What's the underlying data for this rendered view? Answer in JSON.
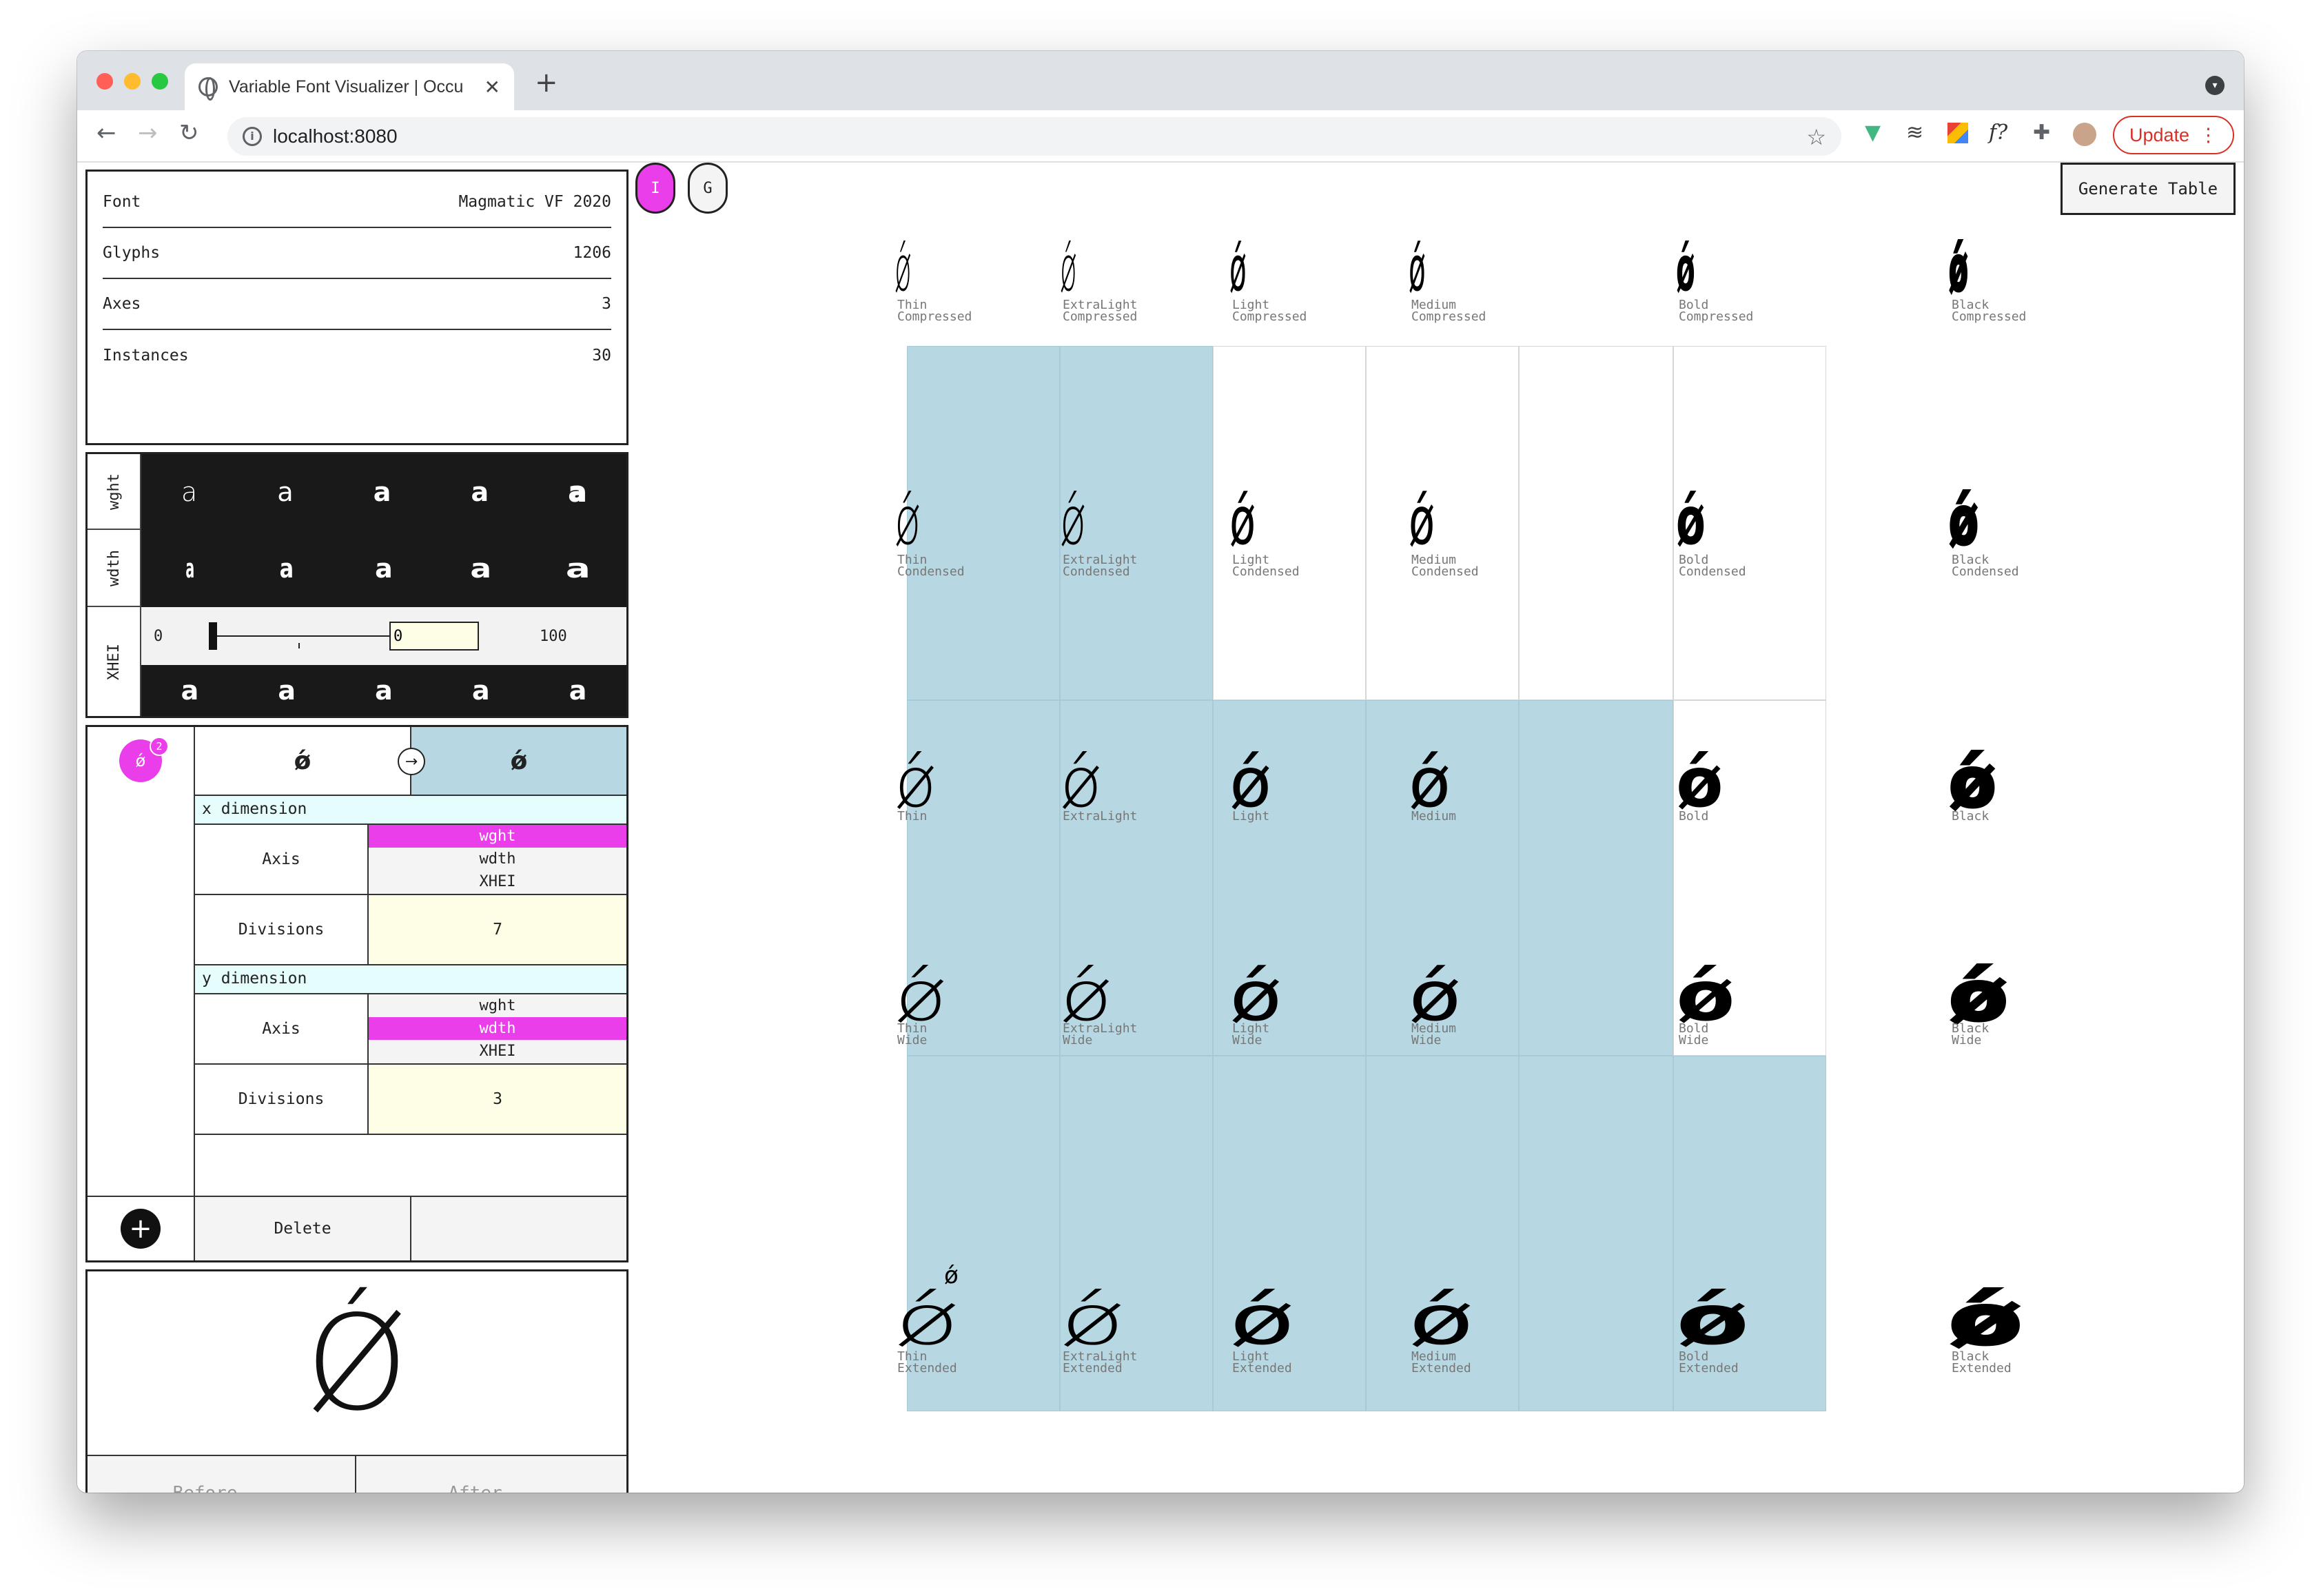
{
  "browser": {
    "tab_title": "Variable Font Visualizer | Occu",
    "url": "localhost:8080",
    "update_label": "Update",
    "extensions": [
      "vue-icon",
      "wave-icon",
      "color-picker-icon",
      "font-ninja-icon",
      "puzzle-icon",
      "profile-avatar"
    ],
    "ext_font_label": "f?"
  },
  "font_info": {
    "rows": [
      {
        "label": "Font",
        "value": "Magmatic VF 2020"
      },
      {
        "label": "Glyphs",
        "value": "1206"
      },
      {
        "label": "Axes",
        "value": "3"
      },
      {
        "label": "Instances",
        "value": "30"
      }
    ]
  },
  "axes_panel": {
    "wght_label": "wght",
    "wdth_label": "wdth",
    "xhei_label": "XHEI",
    "sample_glyph": "a",
    "slider": {
      "min": "0",
      "max": "100",
      "input_value": "0",
      "level": 0
    }
  },
  "dimension_panel": {
    "badge_glyph": "ǿ",
    "badge_count": "2",
    "glyph_from": "ǿ",
    "glyph_to": "ǿ",
    "x_title": "x dimension",
    "y_title": "y dimension",
    "axis_label": "Axis",
    "divisions_label": "Divisions",
    "axis_options": [
      "wght",
      "wdth",
      "XHEI"
    ],
    "x_selected": "wght",
    "y_selected": "wdth",
    "x_divisions": "7",
    "y_divisions": "3",
    "delete_label": "Delete"
  },
  "preview": {
    "glyph": "Ǿ",
    "before_label": "Before...",
    "after_label": "After..."
  },
  "toolbar": {
    "i_label": "I",
    "g_label": "G",
    "generate_label": "Generate Table"
  },
  "grid": {
    "glyph": "ǿ",
    "labels": {
      "r0": [
        "Thin\nCompressed",
        "ExtraLight\nCompressed",
        "Light\nCompressed",
        "Medium\nCompressed",
        "Bold\nCompressed",
        "Black\nCompressed"
      ],
      "r1": [
        "Thin\nCondensed",
        "ExtraLight\nCondensed",
        "Light\nCondensed",
        "Medium\nCondensed",
        "Bold\nCondensed",
        "Black\nCondensed"
      ],
      "r2": [
        "Thin",
        "ExtraLight",
        "Light",
        "Medium",
        "Bold",
        "Black"
      ],
      "r3": [
        "Thin\nWide",
        "ExtraLight\nWide",
        "Light\nWide",
        "Medium\nWide",
        "Bold\nWide",
        "Black\nWide"
      ],
      "r4": [
        "Thin\nExtended",
        "ExtraLight\nExtended",
        "Light\nExtended",
        "Medium\nExtended",
        "Bold\nExtended",
        "Black\nExtended"
      ]
    }
  },
  "colors": {
    "accent": "#e93ee9",
    "highlight": "#b7d8e3",
    "selected_cell": "#e6fdfd",
    "input_fill": "#fefee6"
  }
}
